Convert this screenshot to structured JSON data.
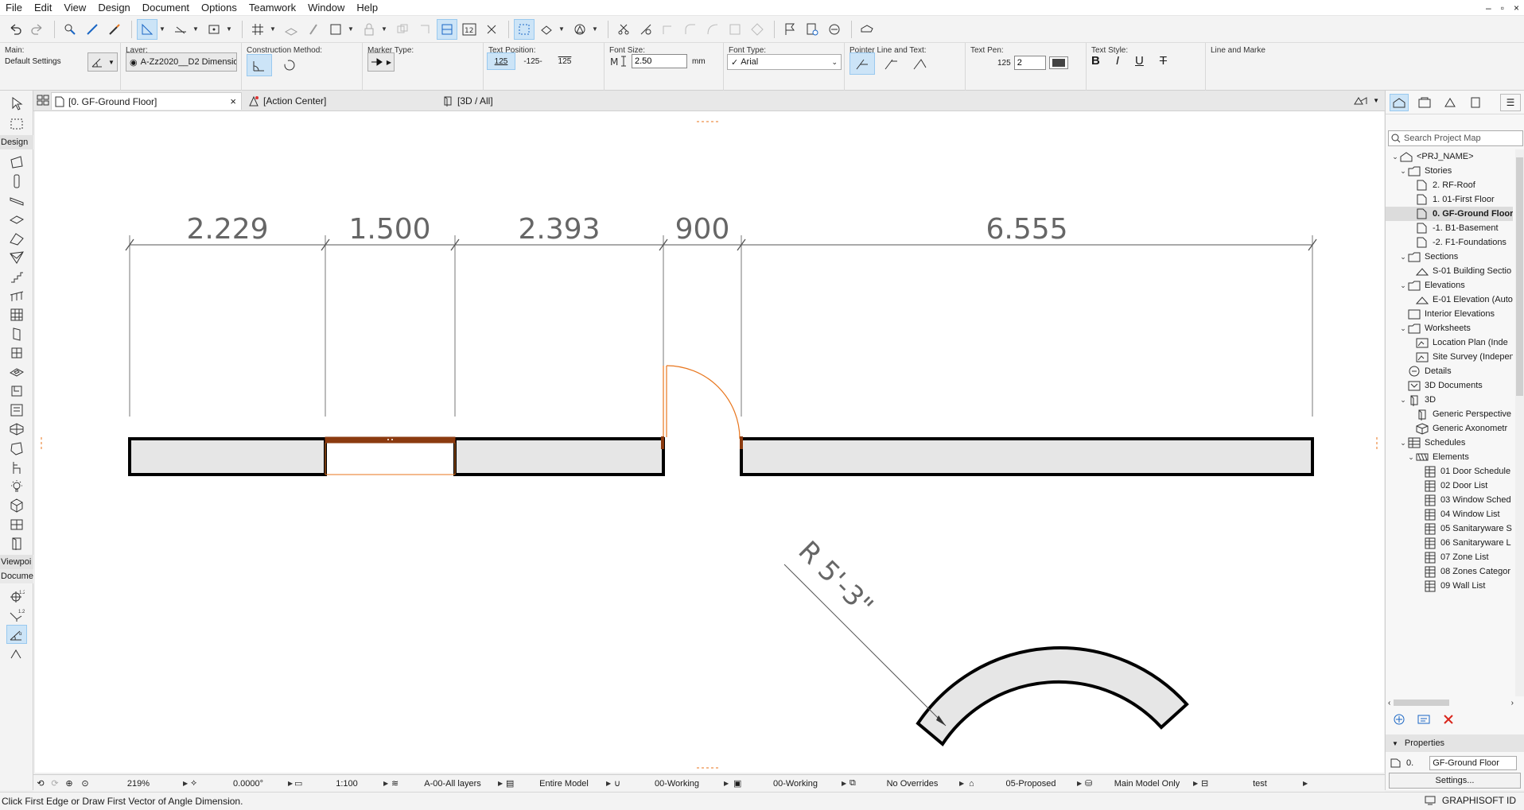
{
  "menu": [
    "File",
    "Edit",
    "View",
    "Design",
    "Document",
    "Options",
    "Teamwork",
    "Window",
    "Help"
  ],
  "window_controls": [
    "–",
    "▫",
    "×"
  ],
  "infobox": {
    "main": {
      "title": "Main:",
      "value": "Default Settings"
    },
    "layer": {
      "title": "Layer:",
      "value": "A-Zz2020__D2 Dimensio..."
    },
    "construction": {
      "title": "Construction Method:"
    },
    "marker": {
      "title": "Marker Type:"
    },
    "text_position": {
      "title": "Text Position:",
      "options": [
        "125",
        "-125-",
        "125"
      ]
    },
    "font_size": {
      "title": "Font Size:",
      "value": "2.50",
      "unit": "mm"
    },
    "font_type": {
      "title": "Font Type:",
      "value": "Arial"
    },
    "pointer": {
      "title": "Pointer Line and Text:"
    },
    "text_pen": {
      "title": "Text Pen:",
      "label": "125",
      "value": "2"
    },
    "text_style": {
      "title": "Text Style:",
      "buttons": [
        "B",
        "I",
        "U",
        "T"
      ]
    },
    "line_marker": {
      "title": "Line and Marke"
    }
  },
  "toolbox": {
    "categories": [
      "Design",
      "Viewpoi",
      "Docume"
    ]
  },
  "tabs": [
    {
      "label": "[0. GF-Ground Floor]",
      "close": "×"
    },
    {
      "label": "[Action Center]"
    },
    {
      "label": "[3D / All]"
    }
  ],
  "drawing": {
    "dimensions": [
      "2.229",
      "1.500",
      "2.393",
      "900",
      "6.555"
    ],
    "radius_label": "R 5'-3\"",
    "colors": {
      "wall_fill": "#e6e6e6",
      "wall_stroke": "#000000",
      "door": "#e8761e",
      "window": "#a0522d",
      "dim": "#444444",
      "text": "#666666"
    }
  },
  "navigator": {
    "search_placeholder": "Search Project Map",
    "tree": [
      {
        "label": "<PRJ_NAME>",
        "indent": 0,
        "chev": "v",
        "icon": "project-icon"
      },
      {
        "label": "Stories",
        "indent": 1,
        "chev": "v",
        "icon": "folder-icon"
      },
      {
        "label": "2. RF-Roof",
        "indent": 2,
        "icon": "story-icon"
      },
      {
        "label": "1. 01-First Floor",
        "indent": 2,
        "icon": "story-icon"
      },
      {
        "label": "0. GF-Ground Floor",
        "indent": 2,
        "icon": "story-icon",
        "selected": true
      },
      {
        "label": "-1. B1-Basement",
        "indent": 2,
        "icon": "story-icon"
      },
      {
        "label": "-2. F1-Foundations",
        "indent": 2,
        "icon": "story-icon"
      },
      {
        "label": "Sections",
        "indent": 1,
        "chev": "v",
        "icon": "folder-icon"
      },
      {
        "label": "S-01 Building Sectio",
        "indent": 2,
        "icon": "section-icon"
      },
      {
        "label": "Elevations",
        "indent": 1,
        "chev": "v",
        "icon": "folder-icon"
      },
      {
        "label": "E-01 Elevation (Auto",
        "indent": 2,
        "icon": "elevation-icon"
      },
      {
        "label": "Interior Elevations",
        "indent": 1,
        "icon": "interior-icon"
      },
      {
        "label": "Worksheets",
        "indent": 1,
        "chev": "v",
        "icon": "folder-icon"
      },
      {
        "label": "Location Plan (Inde",
        "indent": 2,
        "icon": "worksheet-icon"
      },
      {
        "label": "Site Survey (Indepen",
        "indent": 2,
        "icon": "worksheet-icon"
      },
      {
        "label": "Details",
        "indent": 1,
        "icon": "details-icon"
      },
      {
        "label": "3D Documents",
        "indent": 1,
        "icon": "3ddoc-icon"
      },
      {
        "label": "3D",
        "indent": 1,
        "chev": "v",
        "icon": "cube-icon"
      },
      {
        "label": "Generic Perspective",
        "indent": 2,
        "icon": "perspective-icon"
      },
      {
        "label": "Generic Axonometr",
        "indent": 2,
        "icon": "axonometry-icon"
      },
      {
        "label": "Schedules",
        "indent": 1,
        "chev": "v",
        "icon": "schedule-icon"
      },
      {
        "label": "Elements",
        "indent": 2,
        "chev": "v",
        "icon": "elements-icon"
      },
      {
        "label": "01 Door Schedule",
        "indent": 3,
        "icon": "table-icon"
      },
      {
        "label": "02 Door List",
        "indent": 3,
        "icon": "table-icon"
      },
      {
        "label": "03 Window Sched",
        "indent": 3,
        "icon": "table-icon"
      },
      {
        "label": "04 Window List",
        "indent": 3,
        "icon": "table-icon"
      },
      {
        "label": "05 Sanitaryware S",
        "indent": 3,
        "icon": "table-icon"
      },
      {
        "label": "06 Sanitaryware L",
        "indent": 3,
        "icon": "table-icon"
      },
      {
        "label": "07 Zone List",
        "indent": 3,
        "icon": "table-icon"
      },
      {
        "label": "08 Zones Categor",
        "indent": 3,
        "icon": "table-icon"
      },
      {
        "label": "09 Wall List",
        "indent": 3,
        "icon": "table-icon"
      }
    ],
    "properties": {
      "title": "Properties",
      "id": "0.",
      "name": "GF-Ground Floor",
      "settings": "Settings..."
    }
  },
  "quick_options": {
    "zoom": "219%",
    "angle": "0.0000°",
    "scale": "1:100",
    "layer_combo": "A-00-All layers",
    "model_view": "Entire Model",
    "pen_set": "00-Working",
    "mvo": "00-Working",
    "graphic_override": "No Overrides",
    "renovation": "05-Proposed",
    "structural": "Main Model Only",
    "dim": "test"
  },
  "status": {
    "message": "Click First Edge or Draw First Vector of Angle Dimension.",
    "brand": "GRAPHISOFT ID"
  }
}
